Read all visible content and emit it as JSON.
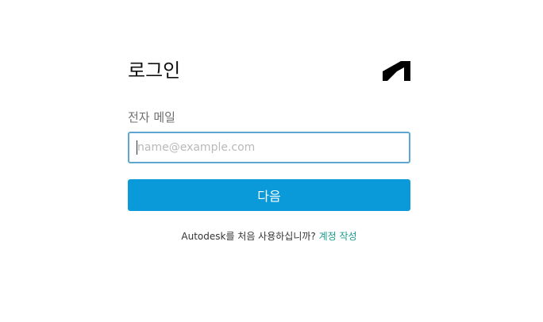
{
  "login": {
    "title": "로그인",
    "email_label": "전자 메일",
    "email_placeholder": "name@example.com",
    "email_value": "",
    "next_button_label": "다음",
    "signup_prompt": "Autodesk를 처음 사용하십니까?",
    "signup_link": "계정 작성"
  },
  "colors": {
    "accent_button": "#0a9ad9",
    "input_border_focus": "#5fa7d1",
    "link": "#1a9a8a"
  },
  "icons": {
    "brand_logo": "autodesk-logo-icon"
  }
}
